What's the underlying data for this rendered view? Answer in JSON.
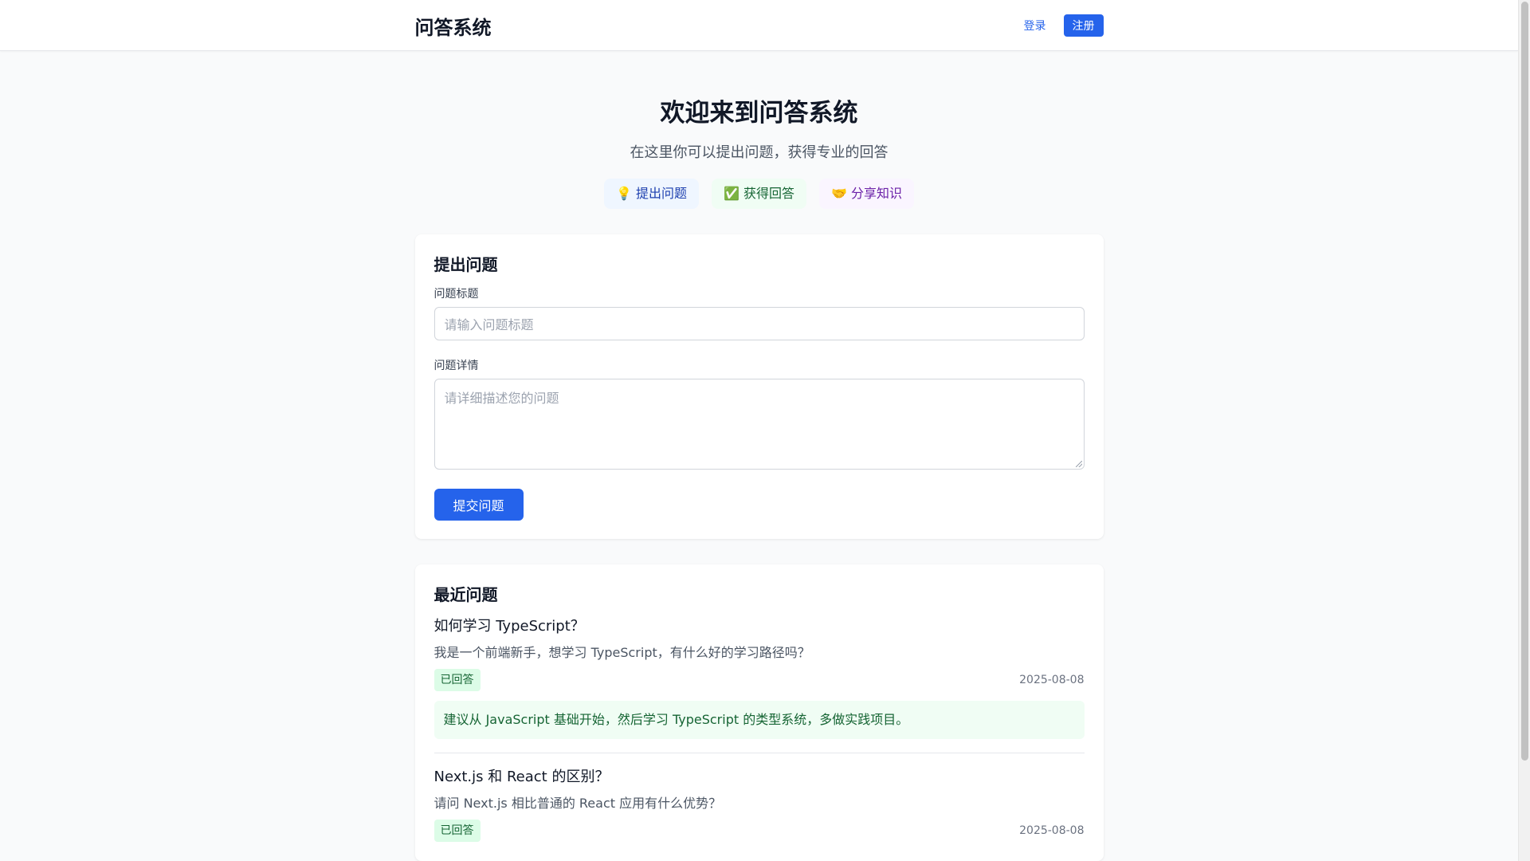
{
  "header": {
    "brand": "问答系统",
    "login_label": "登录",
    "register_label": "注册"
  },
  "hero": {
    "title": "欢迎来到问答系统",
    "subtitle": "在这里你可以提出问题，获得专业的回答",
    "features": [
      {
        "icon": "lightbulb-icon",
        "glyph": "💡",
        "label": "提出问题",
        "color": "#1e40af"
      },
      {
        "icon": "check-icon",
        "glyph": "✅",
        "label": "获得回答",
        "color": "#166534"
      },
      {
        "icon": "handshake-icon",
        "glyph": "🤝",
        "label": "分享知识",
        "color": "#6b21a8"
      }
    ]
  },
  "ask_form": {
    "heading": "提出问题",
    "title_label": "问题标题",
    "title_placeholder": "请输入问题标题",
    "detail_label": "问题详情",
    "detail_placeholder": "请详细描述您的问题",
    "submit_label": "提交问题"
  },
  "recent": {
    "heading": "最近问题",
    "questions": [
      {
        "title": "如何学习 TypeScript？",
        "description": "我是一个前端新手，想学习 TypeScript，有什么好的学习路径吗？",
        "status": "已回答",
        "date": "2025-08-08",
        "answer": "建议从 JavaScript 基础开始，然后学习 TypeScript 的类型系统，多做实践项目。"
      },
      {
        "title": "Next.js 和 React 的区别？",
        "description": "请问 Next.js 相比普通的 React 应用有什么优势？",
        "status": "已回答",
        "date": "2025-08-08"
      }
    ]
  },
  "colors": {
    "accent": "#2563eb",
    "answered_bg": "#dcfce7",
    "answered_text": "#166534"
  }
}
